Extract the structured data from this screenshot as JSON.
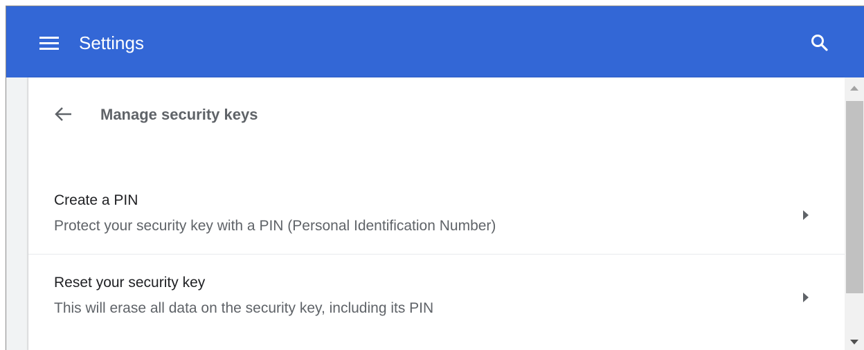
{
  "toolbar": {
    "title": "Settings",
    "menu_icon": "hamburger-menu-icon",
    "search_icon": "search-icon",
    "background_color": "#3367d6"
  },
  "subpage": {
    "back_icon": "arrow-back-icon",
    "title": "Manage security keys"
  },
  "rows": [
    {
      "title": "Create a PIN",
      "subtitle": "Protect your security key with a PIN (Personal Identification Number)",
      "icon": "chevron-right-icon"
    },
    {
      "title": "Reset your security key",
      "subtitle": "This will erase all data on the security key, including its PIN",
      "icon": "chevron-right-icon"
    }
  ]
}
